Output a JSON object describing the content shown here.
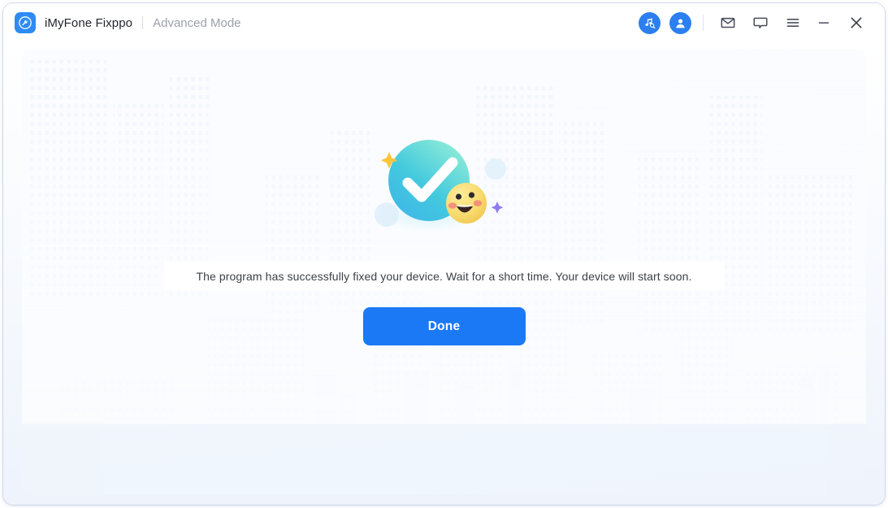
{
  "window": {
    "app_name": "iMyFone Fixppo",
    "mode_label": "Advanced Mode",
    "logo_icon": "wrench-circle-icon"
  },
  "titlebar": {
    "icons": [
      {
        "name": "music-search-icon",
        "label": "Music Search"
      },
      {
        "name": "user-account-icon",
        "label": "Account"
      },
      {
        "name": "mail-icon",
        "label": "Mail"
      },
      {
        "name": "chat-bubble-icon",
        "label": "Feedback"
      },
      {
        "name": "hamburger-menu-icon",
        "label": "Menu"
      },
      {
        "name": "minimize-icon",
        "label": "Minimize"
      },
      {
        "name": "close-icon",
        "label": "Close"
      }
    ]
  },
  "main": {
    "illustration": "success-check-circle-with-smiley-emoji",
    "message": "The program has successfully fixed your device. Wait for a short time. Your device will start soon.",
    "primary_button": "Done"
  },
  "colors": {
    "accent_blue": "#1C79F5",
    "logo_blue": "#2E8BF5",
    "check_teal_light": "#6FE0E0",
    "check_teal_dark": "#35B6E2",
    "emoji_yellow": "#F7DC6B",
    "sparkle_gold": "#FFC94D",
    "sparkle_purple": "#8E7BE8",
    "text_primary": "#23262d",
    "text_muted": "#9aa1ad",
    "icon_gray": "#4A4F5C"
  }
}
